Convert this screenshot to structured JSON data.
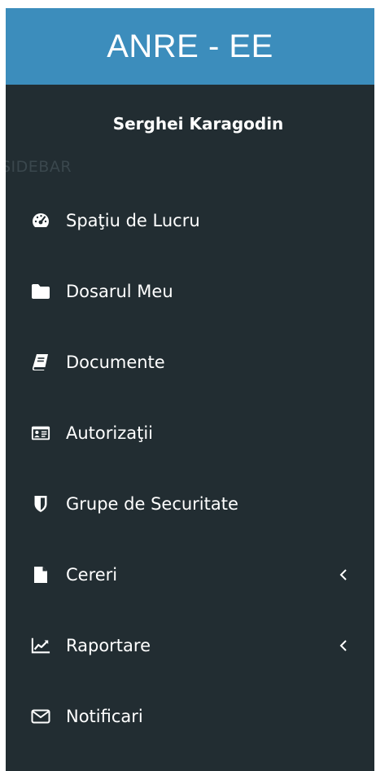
{
  "brand": {
    "title": "ANRE - EE"
  },
  "user": {
    "name": "Serghei Karagodin"
  },
  "sidebar": {
    "section_label": "SIDEBAR",
    "items": [
      {
        "label": "Spaţiu de Lucru",
        "icon": "dashboard-icon"
      },
      {
        "label": "Dosarul Meu",
        "icon": "folder-icon"
      },
      {
        "label": "Documente",
        "icon": "book-icon"
      },
      {
        "label": "Autorizaţii",
        "icon": "id-card-icon"
      },
      {
        "label": "Grupe de Securitate",
        "icon": "shield-icon"
      },
      {
        "label": "Cereri",
        "icon": "file-icon",
        "has_submenu": true
      },
      {
        "label": "Raportare",
        "icon": "line-chart-icon",
        "has_submenu": true
      },
      {
        "label": "Notificari",
        "icon": "envelope-icon"
      }
    ]
  },
  "colors": {
    "header_bg": "#3c8dbc",
    "sidebar_bg": "#222d32",
    "text": "#ffffff",
    "section_label": "#3a474d"
  }
}
